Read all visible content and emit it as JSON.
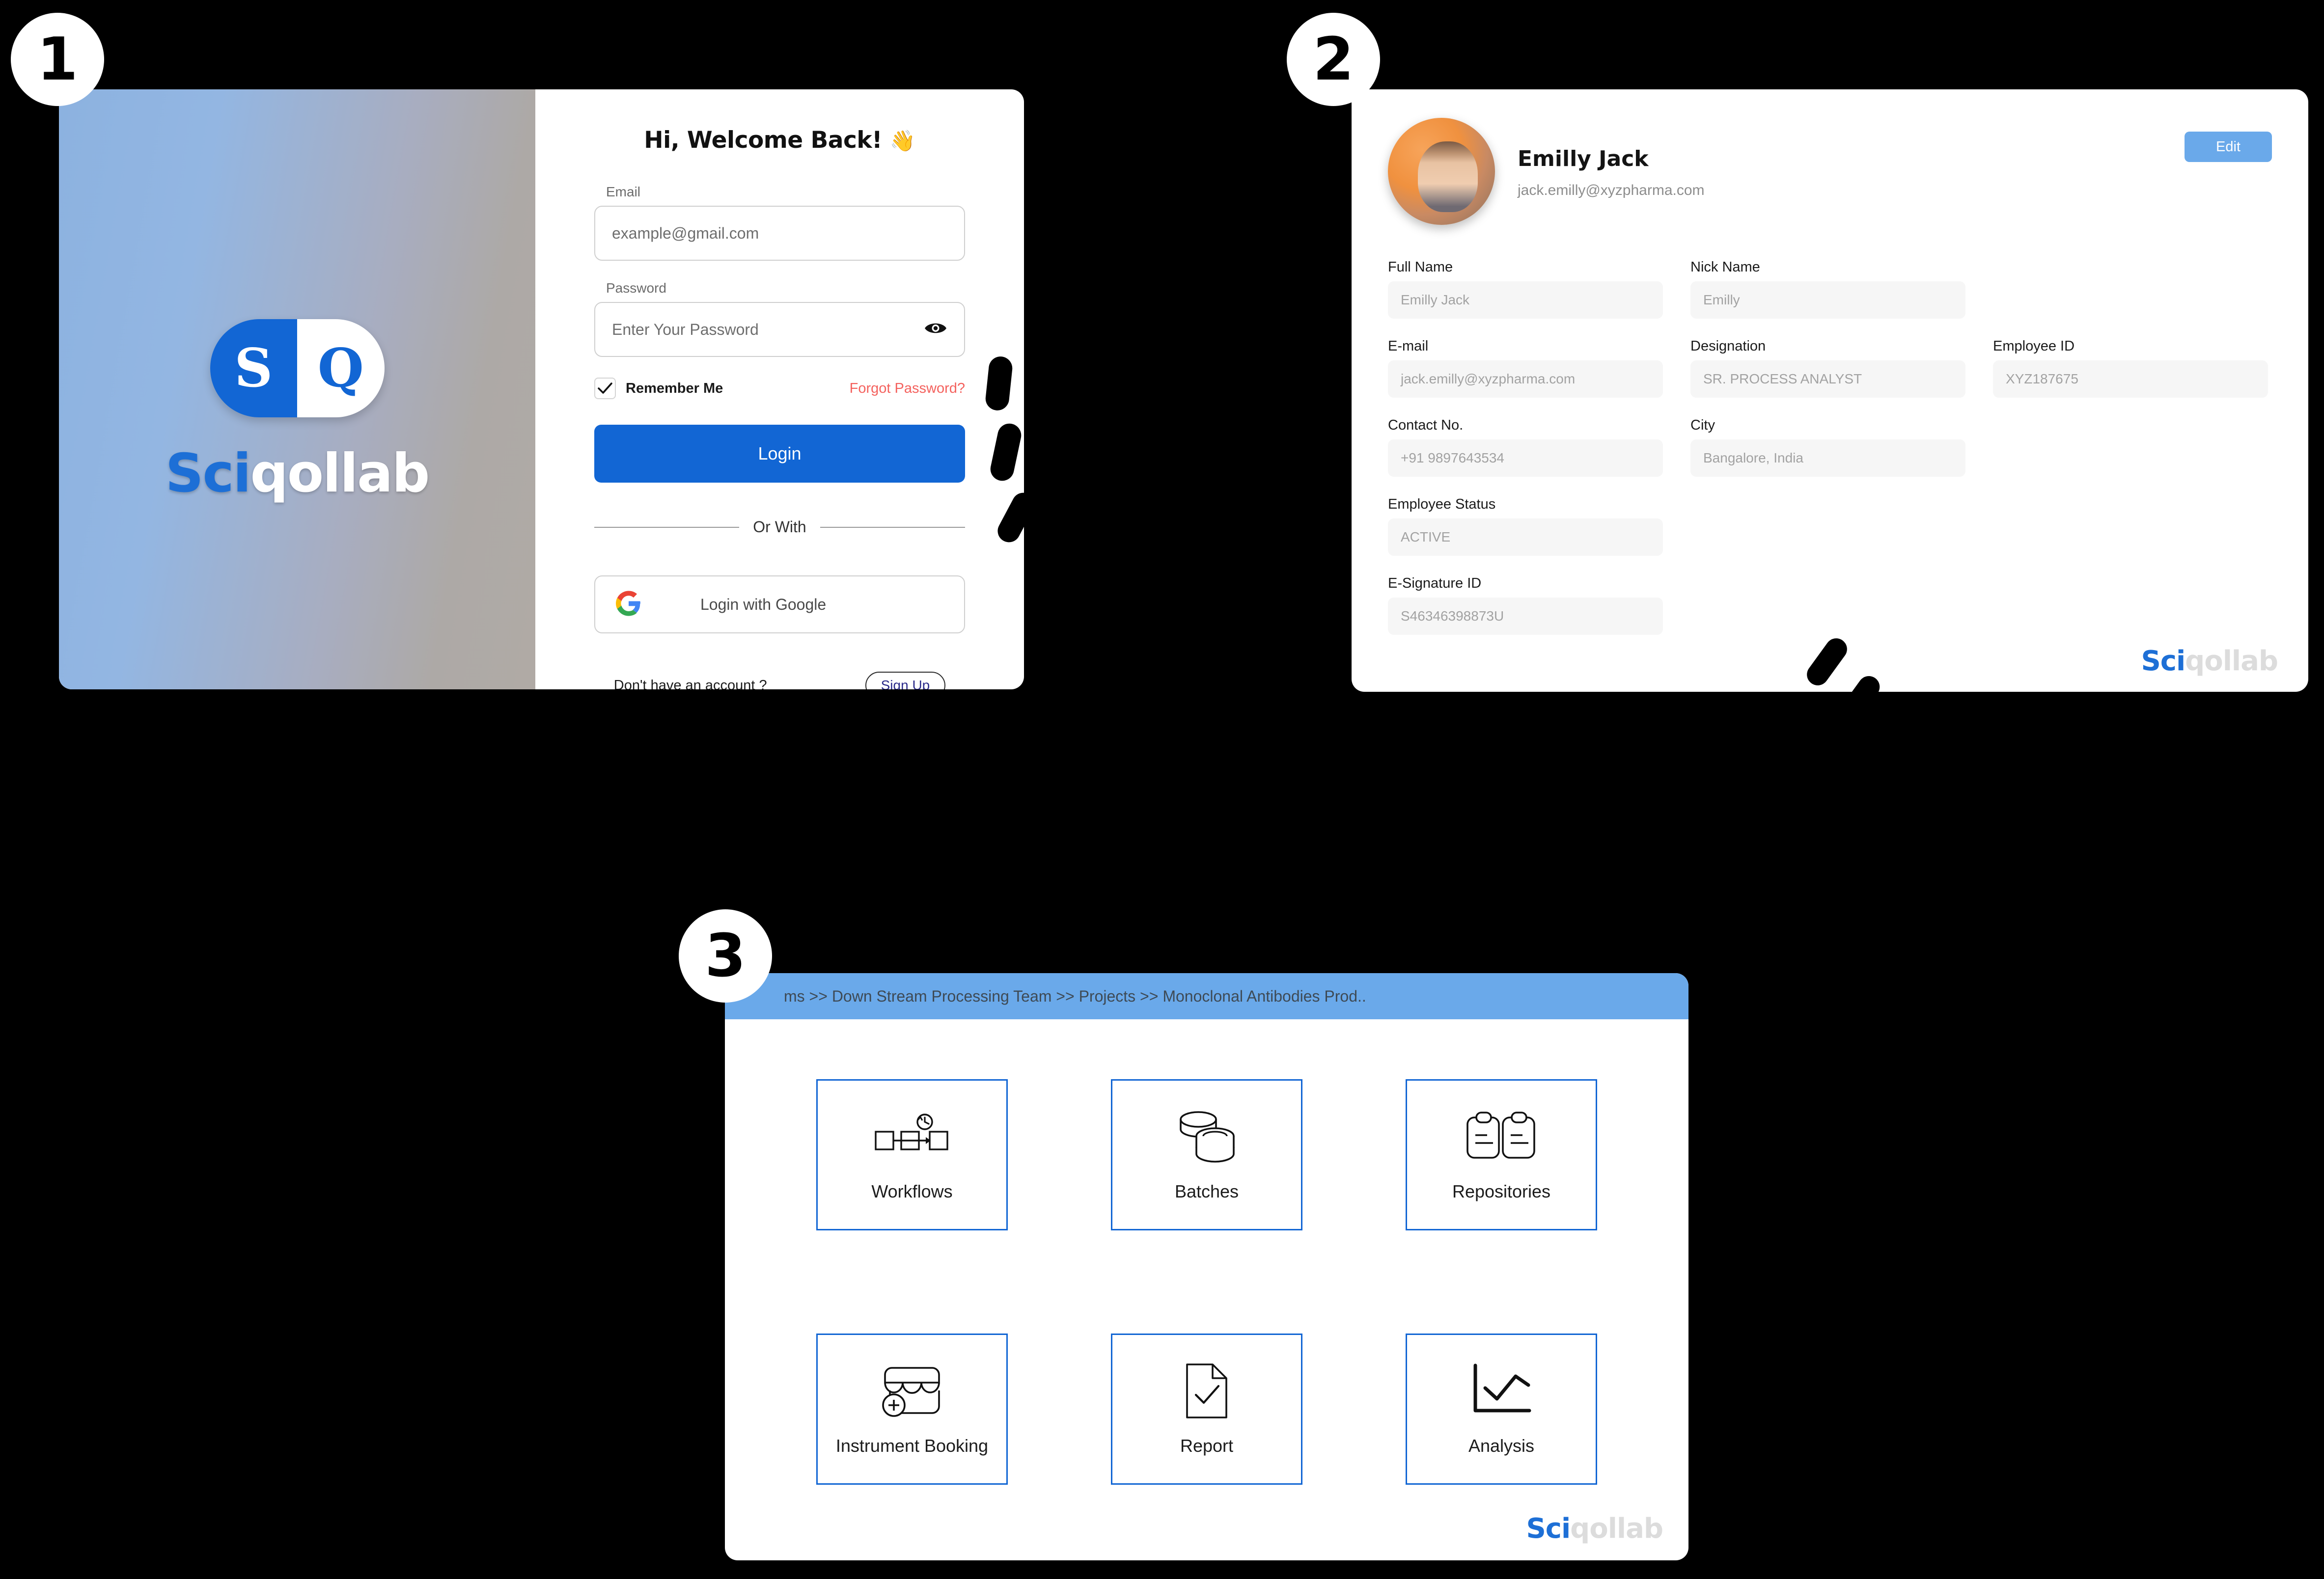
{
  "badges": {
    "one": "1",
    "two": "2",
    "three": "3"
  },
  "brand": {
    "letter_s": "S",
    "letter_q": "Q",
    "part_blue": "Sci",
    "part_light": "qollab"
  },
  "login": {
    "welcome_title": "Hi, Welcome Back!",
    "wave_emoji": "👋",
    "email_label": "Email",
    "email_placeholder": "example@gmail.com",
    "password_label": "Password",
    "password_placeholder": "Enter Your Password",
    "show_password_icon": "eye-icon",
    "remember_label": "Remember Me",
    "remember_checked": true,
    "forgot_label": "Forgot Password?",
    "login_button": "Login",
    "divider_label": "Or With",
    "google_button": "Login with Google",
    "google_icon": "google-g-icon",
    "no_account_text": "Don't have an account ?",
    "signup_button": "Sign Up",
    "accent_blue": "#1266d4",
    "forgot_red": "#f4615d"
  },
  "profile": {
    "name": "Emilly Jack",
    "email": "jack.emilly@xyzpharma.com",
    "edit_button": "Edit",
    "edit_button_color": "#6aa9ea",
    "fields": [
      {
        "label": "Full Name",
        "value": "Emilly Jack"
      },
      {
        "label": "Nick Name",
        "value": "Emilly"
      },
      {
        "label": "E-mail",
        "value": "jack.emilly@xyzpharma.com"
      },
      {
        "label": "Designation",
        "value": "SR. PROCESS ANALYST"
      },
      {
        "label": "Employee ID",
        "value": "XYZ187675"
      },
      {
        "label": "Contact No.",
        "value": "+91 9897643534"
      },
      {
        "label": "City",
        "value": "Bangalore, India"
      },
      {
        "label": "Employee Status",
        "value": "ACTIVE"
      },
      {
        "label": "E-Signature ID",
        "value": "S46346398873U"
      }
    ]
  },
  "modules": {
    "breadcrumb": "ms >> Down Stream Processing Team >> Projects >> Monoclonal Antibodies Prod..",
    "breadcrumb_bg": "#6aa9ea",
    "tile_border": "#1266d4",
    "tiles": [
      {
        "label": "Workflows",
        "icon": "workflow-history-icon"
      },
      {
        "label": "Batches",
        "icon": "stacked-disks-icon"
      },
      {
        "label": "Repositories",
        "icon": "clipboards-icon"
      },
      {
        "label": "Instrument Booking",
        "icon": "shop-plus-icon"
      },
      {
        "label": "Report",
        "icon": "document-check-icon"
      },
      {
        "label": "Analysis",
        "icon": "line-chart-icon"
      }
    ]
  }
}
